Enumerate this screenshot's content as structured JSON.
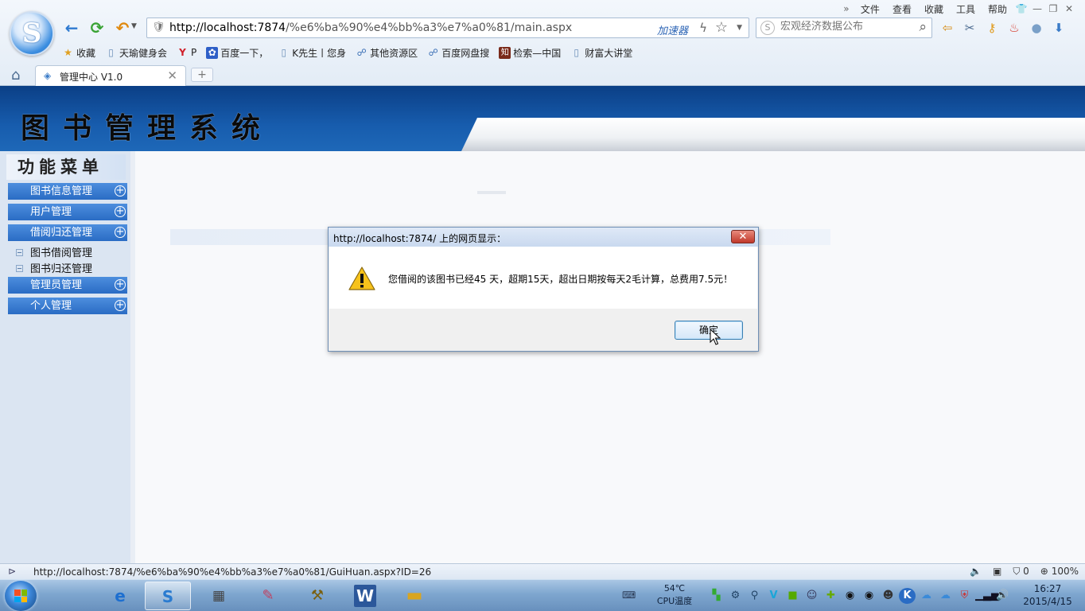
{
  "browser": {
    "menu": [
      "文件",
      "查看",
      "收藏",
      "工具",
      "帮助"
    ],
    "address_url_host": "http://localhost:7874",
    "address_url_path": "/%e6%ba%90%e4%bb%a3%e7%a0%81/main.aspx",
    "accelerator_label": "加速器",
    "search_placeholder": "宏观经济数据公布",
    "bookmarks": [
      "收藏",
      "天瑜健身会",
      "P",
      "百度一下，",
      "K先生丨您身",
      "其他资源区",
      "百度网盘搜",
      "检索—中国",
      "财富大讲堂"
    ],
    "tab_title": "管理中心 V1.0",
    "status_url": "http://localhost:7874/%e6%ba%90%e4%bb%a3%e7%a0%81/GuiHuan.aspx?ID=26",
    "status_count": "0",
    "zoom": "100%"
  },
  "page": {
    "banner_title": "图书管理系统",
    "sidebar_title": "功能菜单",
    "menu": [
      {
        "label": "图书信息管理"
      },
      {
        "label": "用户管理"
      },
      {
        "label": "借阅归还管理"
      },
      {
        "label": "管理员管理"
      },
      {
        "label": "个人管理"
      }
    ],
    "submenu": [
      "图书借阅管理",
      "图书归还管理"
    ]
  },
  "dialog": {
    "title": "http://localhost:7874/ 上的网页显示：",
    "message": "您借阅的该图书已经45 天，超期15天，超出日期按每天2毛计算，总费用7.5元！",
    "ok_label": "确定",
    "close_glyph": "✕"
  },
  "taskbar": {
    "temperature": "54℃",
    "temperature_label": "CPU温度",
    "time": "16:27",
    "date": "2015/4/15"
  },
  "colors": {
    "banner_blue": "#175cad",
    "menu_blue": "#2a6cc4",
    "dialog_border": "#6f8fb5"
  }
}
